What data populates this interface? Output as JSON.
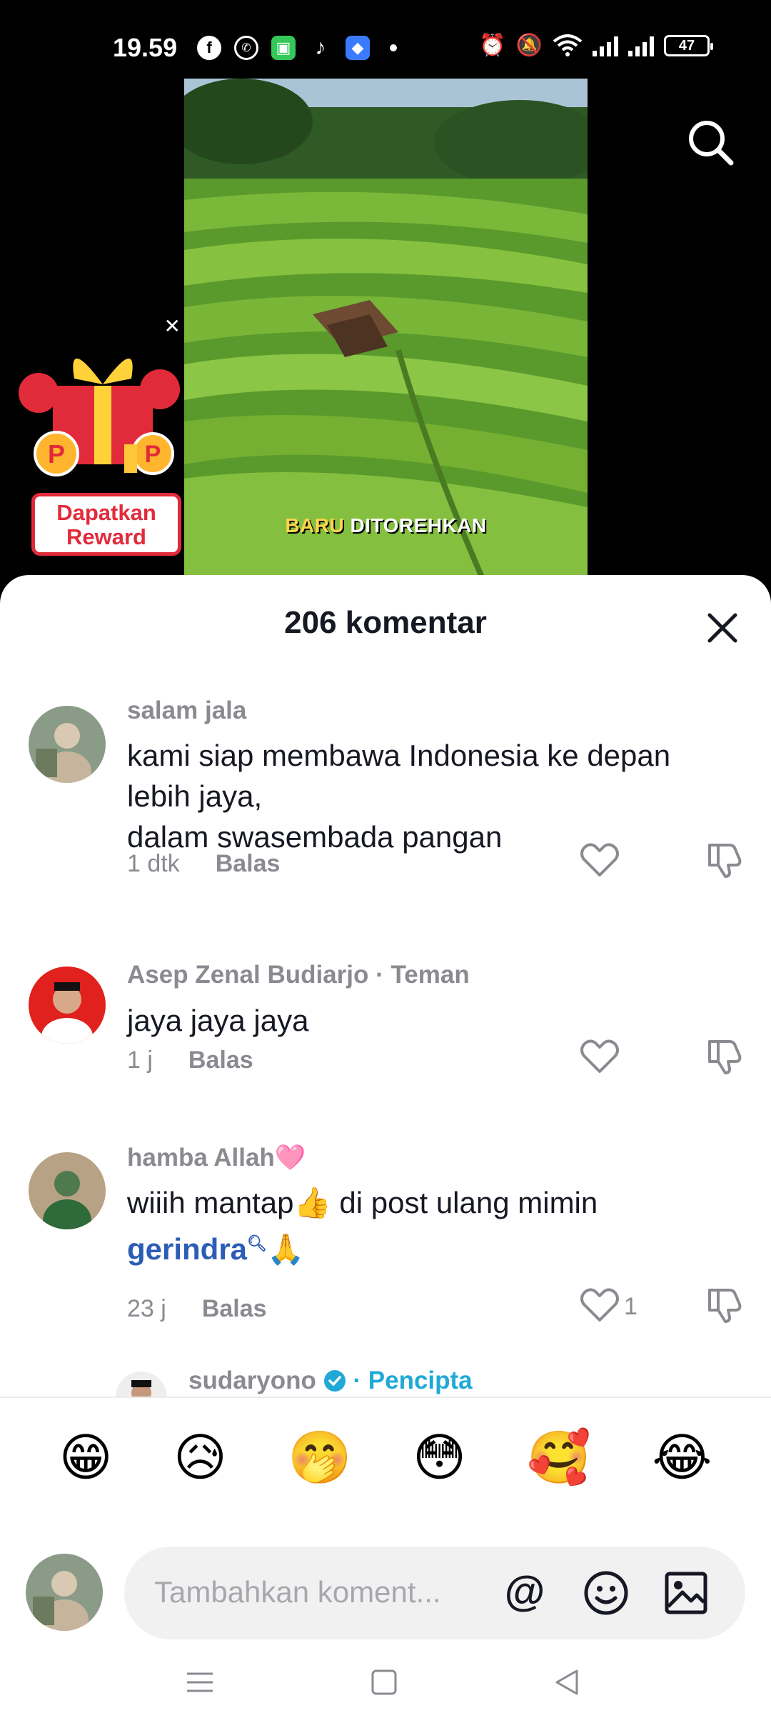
{
  "status_bar": {
    "time": "19.59",
    "battery": "47",
    "app_icons": [
      "facebook-icon",
      "whatsapp-icon",
      "green-app-icon",
      "tiktok-icon",
      "blue-app-icon"
    ]
  },
  "video": {
    "caption_highlight": "BARU",
    "caption_rest": "DITOREHKAN"
  },
  "reward": {
    "line1": "Dapatkan",
    "line2": "Reward"
  },
  "comments_panel": {
    "title": "206 komentar",
    "comments": [
      {
        "user": "salam jala",
        "text_lines": [
          "kami siap membawa Indonesia ke depan",
          "lebih jaya,",
          "dalam swasembada pangan"
        ],
        "time": "1 dtk",
        "reply": "Balas"
      },
      {
        "user": "Asep Zenal Budiarjo",
        "tag": " · Teman",
        "text": "jaya jaya jaya",
        "time": "1 j",
        "reply": "Balas"
      },
      {
        "user": "hamba Allah🩷",
        "text_line1": "wiiih mantap👍 di post ulang mimin",
        "text_link": "gerindra",
        "text_after_link": "🙏",
        "time": "23 j",
        "reply": "Balas",
        "likes": "1"
      },
      {
        "user": "sudaryono",
        "tag": " · Pencipta"
      }
    ]
  },
  "quick_emojis": [
    "😁",
    "😥",
    "🤭",
    "😳",
    "🥰",
    "😂"
  ],
  "composer": {
    "placeholder": "Tambahkan koment..."
  },
  "colors": {
    "accent_link": "#2b5db6",
    "creator_tag": "#20a9d6",
    "reward_red": "#e12b3b"
  }
}
